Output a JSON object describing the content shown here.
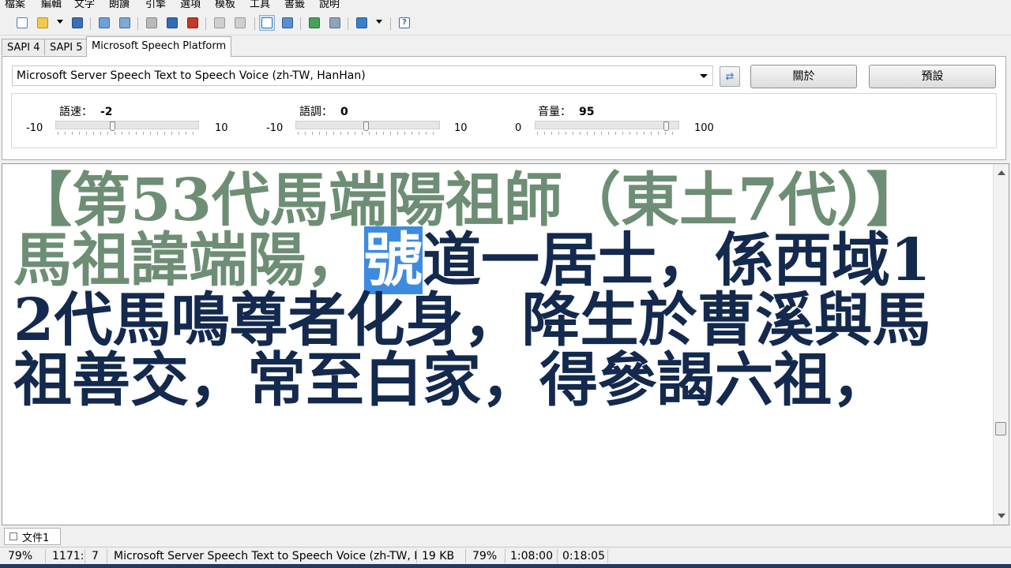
{
  "menu": {
    "items": [
      "檔案",
      "編輯",
      "文字",
      "朗讀",
      "引擎",
      "選項",
      "模板",
      "工具",
      "書籤",
      "說明"
    ]
  },
  "toolbar": {
    "buttons": [
      {
        "icon": "new-file-icon"
      },
      {
        "icon": "open-folder-icon"
      },
      {
        "icon": "dropdown-arrow-icon"
      },
      {
        "icon": "save-icon"
      },
      {
        "icon": "copy-icon"
      },
      {
        "icon": "paste-icon"
      },
      {
        "icon": "play-icon"
      },
      {
        "icon": "pause-icon"
      },
      {
        "icon": "stop-icon"
      },
      {
        "icon": "read-word-icon"
      },
      {
        "icon": "read-sentence-icon"
      },
      {
        "icon": "text-mode-icon",
        "active": true
      },
      {
        "icon": "bookmark-icon"
      },
      {
        "icon": "convert-icon"
      },
      {
        "icon": "export-icon"
      },
      {
        "icon": "audio-file-icon"
      },
      {
        "icon": "help-icon"
      }
    ]
  },
  "engine_tabs": [
    "SAPI 4",
    "SAPI 5",
    "Microsoft Speech Platform"
  ],
  "engine_active_tab": "Microsoft Speech Platform",
  "voice": {
    "selected": "Microsoft Server Speech Text to Speech Voice (zh-TW, HanHan)",
    "about_button": "關於",
    "default_button": "預設"
  },
  "sliders": {
    "rate": {
      "label": "語速：",
      "value": "-2",
      "min": "-10",
      "max": "10",
      "level": 0.4
    },
    "pitch": {
      "label": "語調：",
      "value": "0",
      "min": "-10",
      "max": "10",
      "level": 0.5
    },
    "volume": {
      "label": "音量：",
      "value": "95",
      "min": "0",
      "max": "100",
      "level": 0.95
    }
  },
  "document": {
    "read_text": "【第53代馬端陽祖師（東土7代）】馬祖諱端陽，",
    "highlighted": "號",
    "rest_line": "道一居士，係西域12",
    "rest_text": "代馬鳴尊者化身，降生於曹溪與馬祖善交，常至白家，得參謁六祖，"
  },
  "doc_tabs": [
    "文件1"
  ],
  "status": {
    "zoom": "79%",
    "position": "1171:",
    "column": "7",
    "voice": "Microsoft Server Speech Text to Speech Voice (zh-TW, H",
    "size": "19 KB",
    "progress": "79%",
    "total_time": "1:08:00",
    "elapsed_time": "0:18:05"
  },
  "colors": {
    "read_text": "#6d8e74",
    "unread_text": "#13294d",
    "highlight_bg": "#3d8be0"
  }
}
